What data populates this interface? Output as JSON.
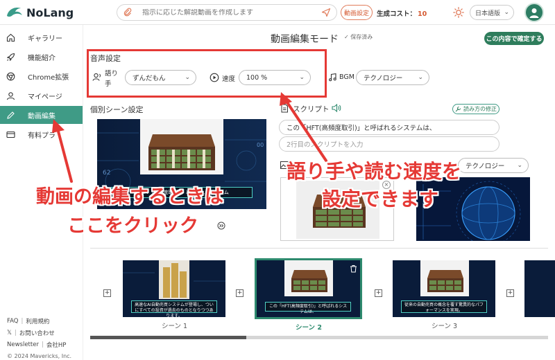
{
  "header": {
    "logo_text": "NoLang",
    "prompt_placeholder": "指示に応じた解説動画を作成します",
    "video_settings_label": "動画設定",
    "cost_label": "生成コスト：",
    "cost_value": "10",
    "language": "日本語版"
  },
  "sidebar": {
    "items": [
      {
        "label": "ギャラリー",
        "icon": "home-icon"
      },
      {
        "label": "機能紹介",
        "icon": "rocket-icon"
      },
      {
        "label": "Chrome拡張",
        "icon": "chrome-icon"
      },
      {
        "label": "マイページ",
        "icon": "user-icon"
      },
      {
        "label": "動画編集",
        "icon": "pencil-icon"
      },
      {
        "label": "有料プラ",
        "icon": "card-icon"
      }
    ],
    "footer": {
      "faq": "FAQ",
      "terms": "利用規約",
      "x": "𝕏",
      "contact": "お問い合わせ",
      "newsletter": "Newsletter",
      "company": "会社HP",
      "copyright": "© 2024 Mavericks, Inc."
    }
  },
  "main": {
    "title": "動画編集モード",
    "saved": "保存済み",
    "confirm_label": "この内容で確定する",
    "voice": {
      "section_title": "音声設定",
      "speaker_label_1": "語り",
      "speaker_label_2": "手",
      "speaker_value": "ずんだもん",
      "speed_label": "速度",
      "speed_value": "100 %",
      "bgm_label": "BGM",
      "bgm_value": "テクノロジー"
    },
    "scene_settings_title": "個別シーン設定",
    "scene_caption": "「HFT（高頻度取引）」と呼ばれるシステム",
    "script": {
      "title": "スクリプト",
      "fix_label": "読み方の修正",
      "line1": "この「HFT(高頻度取引)」と呼ばれるシステムは、",
      "line2_placeholder": "2行目のスクリプトを入力",
      "image_select": "テクノロジー"
    },
    "timeline": [
      {
        "label": "シーン 1",
        "caption": "高速なAI自動売買システムが登場し、ついにすべての投資が過去のものとなりつつあります。"
      },
      {
        "label": "シーン 2",
        "caption": "この「HFT(高頻度取引)」と呼ばれるシステムは、"
      },
      {
        "label": "シーン 3",
        "caption": "従来の自動売買の概念を覆す驚異的なパフォーマンスを実現。"
      }
    ]
  },
  "annotations": {
    "left_line1": "動画の編集するときは",
    "left_line2": "ここをクリック",
    "right_line1": "語り手や読む速度を",
    "right_line2": "設定できます"
  },
  "colors": {
    "accent_green": "#3f9b86",
    "confirm_green": "#2e7d5c",
    "annotation_red": "#e53935",
    "cost_orange": "#d55a32"
  }
}
